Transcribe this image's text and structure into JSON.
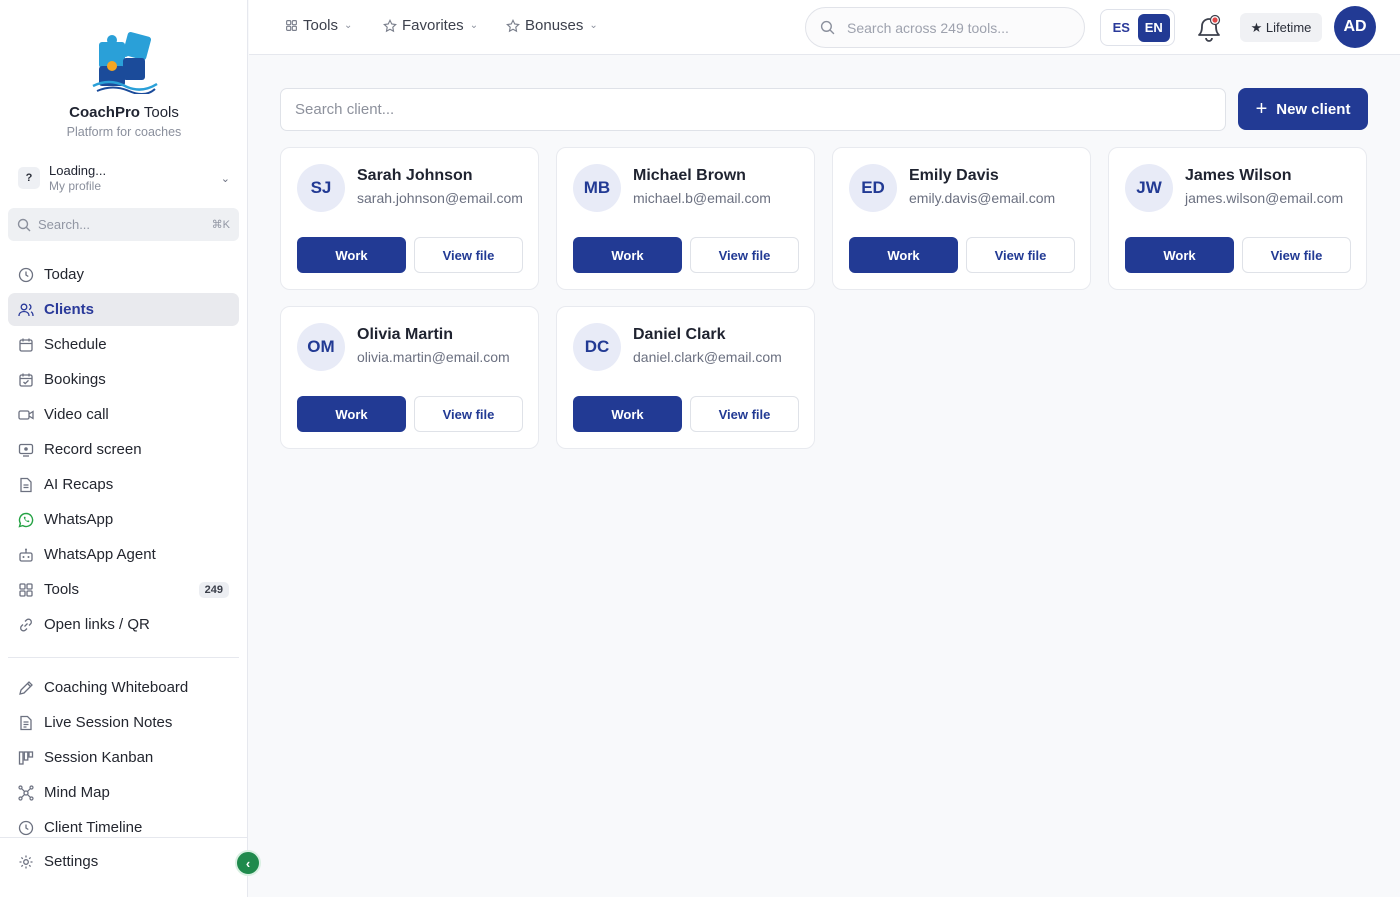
{
  "app": {
    "name_bold": "CoachPro",
    "name_rest": " Tools",
    "tagline": "Platform for coaches"
  },
  "profile": {
    "initial": "?",
    "name": "Loading...",
    "subtitle": "My profile"
  },
  "sidebar_search": {
    "placeholder": "Search...",
    "shortcut": "⌘K"
  },
  "sidebar": {
    "main_items": [
      {
        "label": "Today",
        "icon": "clock-icon"
      },
      {
        "label": "Clients",
        "icon": "users-icon",
        "active": true
      },
      {
        "label": "Schedule",
        "icon": "calendar-icon"
      },
      {
        "label": "Bookings",
        "icon": "calendar-check-icon"
      },
      {
        "label": "Video call",
        "icon": "video-icon"
      },
      {
        "label": "Record screen",
        "icon": "screen-record-icon"
      },
      {
        "label": "AI Recaps",
        "icon": "document-icon"
      },
      {
        "label": "WhatsApp",
        "icon": "whatsapp-icon"
      },
      {
        "label": "WhatsApp Agent",
        "icon": "bot-icon"
      },
      {
        "label": "Tools",
        "icon": "grid-icon",
        "badge": "249"
      },
      {
        "label": "Open links / QR",
        "icon": "link-icon"
      }
    ],
    "tool_items": [
      {
        "label": "Coaching Whiteboard",
        "icon": "pen-icon"
      },
      {
        "label": "Live Session Notes",
        "icon": "notes-icon"
      },
      {
        "label": "Session Kanban",
        "icon": "kanban-icon"
      },
      {
        "label": "Mind Map",
        "icon": "mindmap-icon"
      },
      {
        "label": "Client Timeline",
        "icon": "clock-icon"
      }
    ],
    "settings_label": "Settings"
  },
  "topbar": {
    "tools_label": "Tools",
    "favorites_label": "Favorites",
    "bonuses_label": "Bonuses",
    "search_placeholder": "Search across 249 tools...",
    "lang_es": "ES",
    "lang_en": "EN",
    "lang_selected": "EN",
    "lifetime_label": "★ Lifetime",
    "avatar_initials": "AD"
  },
  "main": {
    "client_search_placeholder": "Search client...",
    "new_client_label": "New client",
    "work_label": "Work",
    "view_label": "View file",
    "clients": [
      {
        "initials": "SJ",
        "name": "Sarah Johnson",
        "email": "sarah.johnson@email.com"
      },
      {
        "initials": "MB",
        "name": "Michael Brown",
        "email": "michael.b@email.com"
      },
      {
        "initials": "ED",
        "name": "Emily Davis",
        "email": "emily.davis@email.com"
      },
      {
        "initials": "JW",
        "name": "James Wilson",
        "email": "james.wilson@email.com"
      },
      {
        "initials": "OM",
        "name": "Olivia Martin",
        "email": "olivia.martin@email.com"
      },
      {
        "initials": "DC",
        "name": "Daniel Clark",
        "email": "daniel.clark@email.com"
      }
    ]
  },
  "colors": {
    "primary": "#223a94",
    "avatar_bg": "#e8ebf7",
    "whatsapp": "#25a244",
    "collapse": "#1f8a4c"
  }
}
